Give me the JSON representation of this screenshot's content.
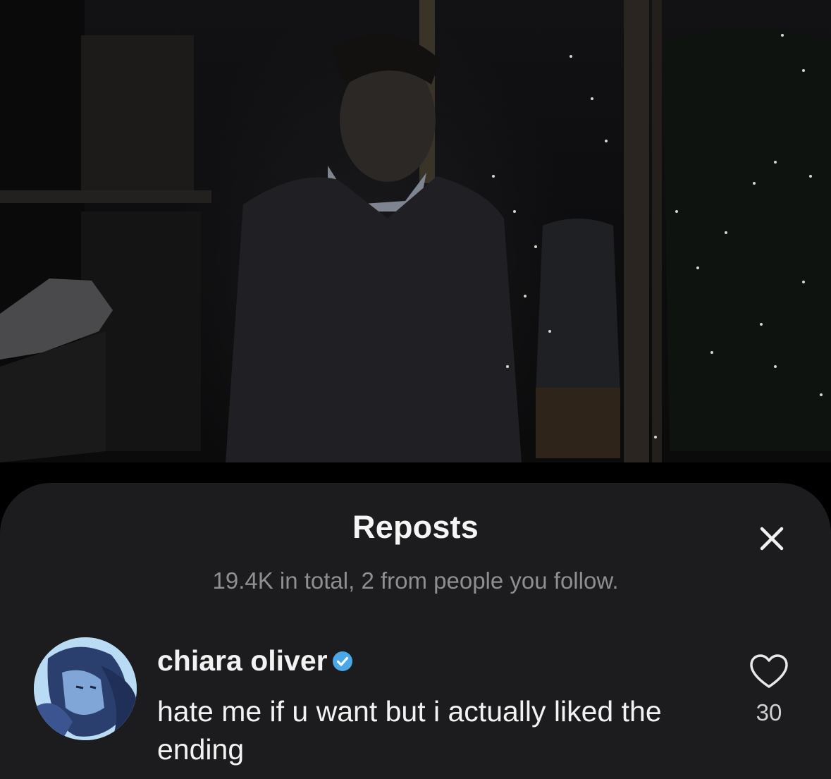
{
  "video": {
    "alt_icon": "video-frame"
  },
  "sheet": {
    "title": "Reposts",
    "subtitle": "19.4K in total, 2 from people you follow.",
    "close_icon": "close-icon"
  },
  "reposts": [
    {
      "username": "chiara oliver",
      "verified": true,
      "caption": "hate me if u want but i actually liked the ending",
      "like_count": "30"
    }
  ],
  "colors": {
    "sheet_bg": "#1c1c1e",
    "text_primary": "#f2f2f2",
    "text_secondary": "#8e8e93",
    "verified_blue": "#4aa8e8"
  }
}
